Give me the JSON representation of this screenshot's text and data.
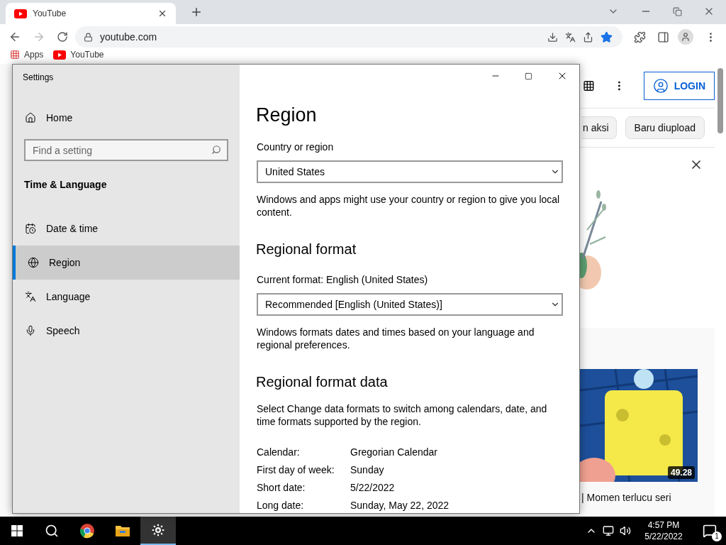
{
  "browser": {
    "tab": {
      "title": "YouTube",
      "selected": true
    },
    "address": "youtube.com",
    "bookmarked": true,
    "bookmarks": [
      "Apps",
      "YouTube"
    ]
  },
  "youtube": {
    "login": "LOGIN",
    "chips": [
      "n aksi",
      "Baru diupload"
    ],
    "video": {
      "duration": "49.28",
      "title": "| Momen terlucu seri"
    }
  },
  "settings": {
    "title": "Settings",
    "home": "Home",
    "search": {
      "placeholder": "Find a setting"
    },
    "section": "Time & Language",
    "nav": [
      {
        "label": "Date & time",
        "selected": false
      },
      {
        "label": "Region",
        "selected": true
      },
      {
        "label": "Language",
        "selected": false
      },
      {
        "label": "Speech",
        "selected": false
      }
    ],
    "page": {
      "heading": "Region",
      "country": {
        "label": "Country or region",
        "value": "United States",
        "note": "Windows and apps might use your country or region to give you local content."
      },
      "regional_format": {
        "heading": "Regional format",
        "label": "Current format: English (United States)",
        "value": "Recommended [English (United States)]",
        "note": "Windows formats dates and times based on your language and regional preferences."
      },
      "format_data": {
        "heading": "Regional format data",
        "note": "Select Change data formats to switch among calendars, date, and time formats supported by the region.",
        "rows": [
          {
            "label": "Calendar:",
            "value": "Gregorian Calendar"
          },
          {
            "label": "First day of week:",
            "value": "Sunday"
          },
          {
            "label": "Short date:",
            "value": "5/22/2022"
          },
          {
            "label": "Long date:",
            "value": "Sunday, May 22, 2022"
          }
        ]
      }
    }
  },
  "taskbar": {
    "apps": [
      {
        "selected": false
      },
      {
        "selected": false
      },
      {
        "selected": false
      },
      {
        "selected": true
      }
    ],
    "time": "4:57 PM",
    "date": "5/22/2022",
    "notifications": "1"
  }
}
